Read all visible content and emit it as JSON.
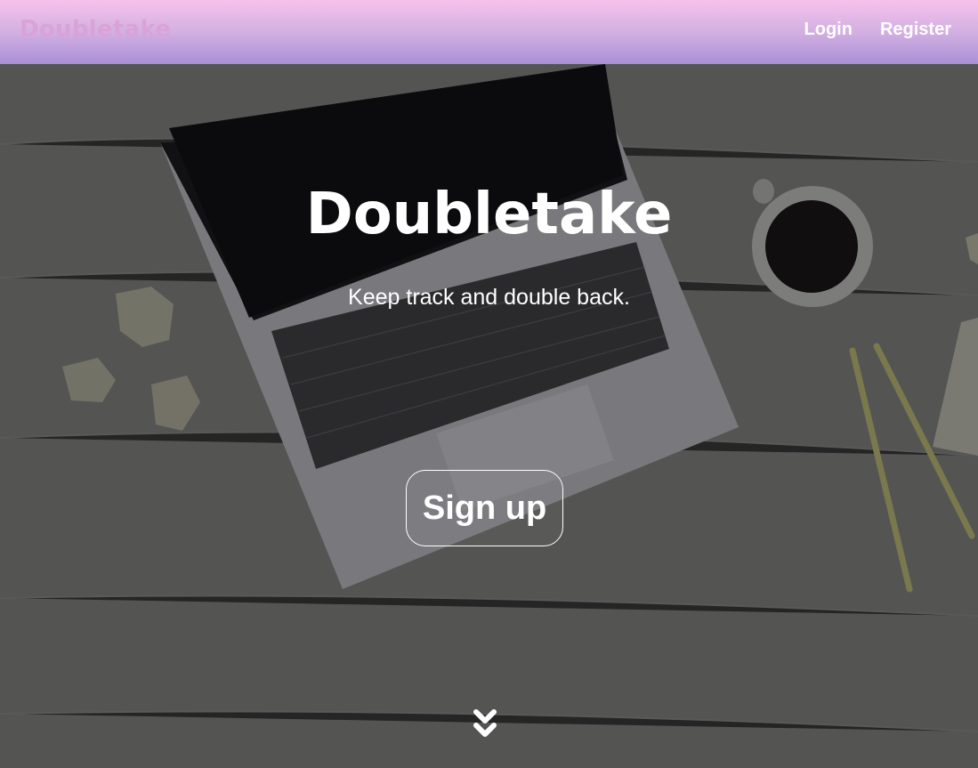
{
  "navbar": {
    "brand": "Doubletake",
    "links": [
      {
        "label": "Login"
      },
      {
        "label": "Register"
      }
    ]
  },
  "hero": {
    "title": "Doubletake",
    "subtitle": "Keep track and double back.",
    "cta_label": "Sign up",
    "scroll_icon": "chevron-double-down-icon",
    "background": "desk-with-laptop-coffee-pencils-photo"
  },
  "colors": {
    "navbar_top": "#f6c2ea",
    "navbar_bottom": "#a990d6",
    "brand_text": "#d9a3d8",
    "hero_text": "#ffffff"
  }
}
